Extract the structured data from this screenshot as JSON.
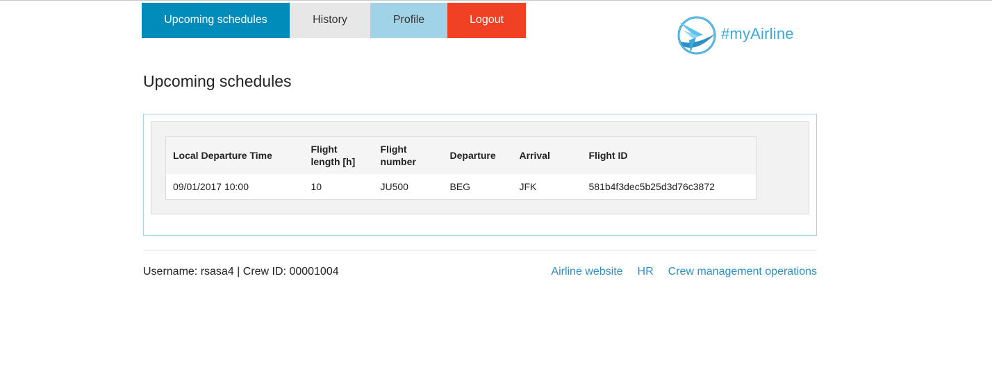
{
  "nav": {
    "tabs": [
      {
        "label": "Upcoming schedules",
        "color": "#008cba"
      },
      {
        "label": "History",
        "color": "#e7e7e7"
      },
      {
        "label": "Profile",
        "color": "#a0d3e8"
      },
      {
        "label": "Logout",
        "color": "#f04124"
      }
    ]
  },
  "logo": {
    "text": "#myAirline",
    "icon": "airplane-swoosh-icon",
    "color": "#3aa8d8"
  },
  "page": {
    "title": "Upcoming schedules"
  },
  "table": {
    "headers": {
      "departure_time": "Local Departure Time",
      "flight_length": "Flight length [h]",
      "flight_number": "Flight number",
      "departure": "Departure",
      "arrival": "Arrival",
      "flight_id": "Flight ID"
    },
    "rows": [
      {
        "departure_time": "09/01/2017 10:00",
        "flight_length": "10",
        "flight_number": "JU500",
        "departure": "BEG",
        "arrival": "JFK",
        "flight_id": "581b4f3dec5b25d3d76c3872"
      }
    ]
  },
  "footer": {
    "user_info": "Username: rsasa4 | Crew ID: 00001004",
    "links": [
      "Airline website",
      "HR",
      "Crew management operations"
    ],
    "link_color": "#2b8fc7"
  }
}
